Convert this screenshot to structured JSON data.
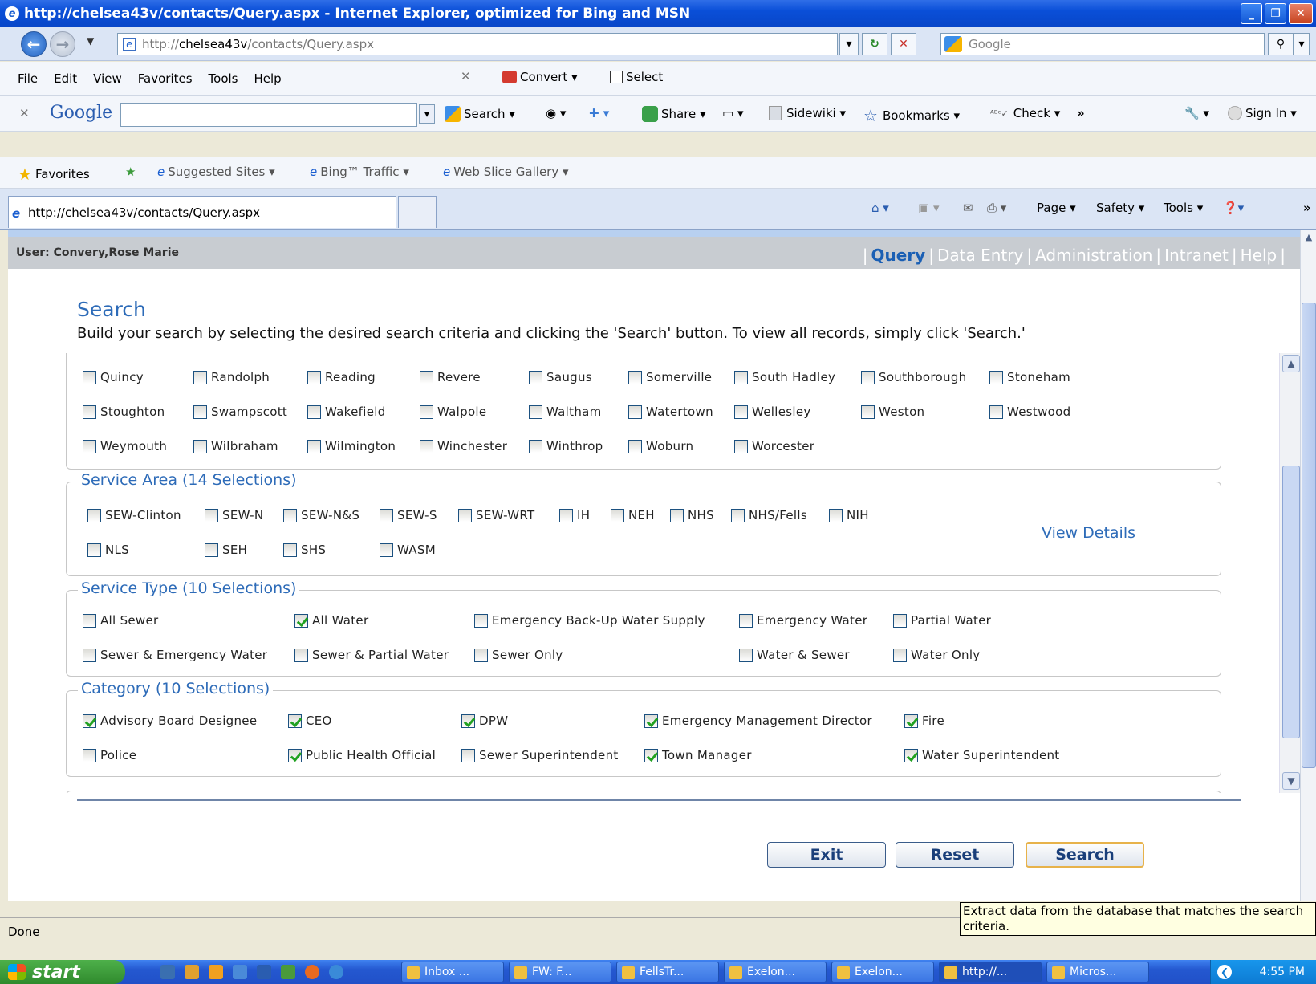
{
  "window": {
    "title": "http://chelsea43v/contacts/Query.aspx - Internet Explorer, optimized for Bing and MSN"
  },
  "addressbar": {
    "url_prefix": "http://",
    "url_host": "chelsea43v",
    "url_path": "/contacts/Query.aspx",
    "search_placeholder": "Google"
  },
  "menubar": {
    "items": [
      "File",
      "Edit",
      "View",
      "Favorites",
      "Tools",
      "Help"
    ],
    "convert_label": "Convert",
    "select_label": "Select"
  },
  "googlebar": {
    "logo": "Google",
    "search_label": "Search",
    "share_label": "Share",
    "sidewiki_label": "Sidewiki",
    "bookmarks_label": "Bookmarks",
    "check_label": "Check",
    "more_label": "»",
    "signin_label": "Sign In"
  },
  "favbar": {
    "favorites_label": "Favorites",
    "suggested_label": "Suggested Sites",
    "bing_label": "Bing™ Traffic",
    "webslice_label": "Web Slice Gallery"
  },
  "tabs": {
    "active_tab": "http://chelsea43v/contacts/Query.aspx",
    "page_label": "Page",
    "safety_label": "Safety",
    "tools_label": "Tools"
  },
  "page": {
    "user_label": "User: Convery,Rose Marie",
    "nav": [
      "Query",
      "Data Entry",
      "Administration",
      "Intranet",
      "Help"
    ],
    "active_nav": "Query",
    "search_title": "Search",
    "search_desc": "Build your search by selecting the desired search criteria and clicking the 'Search' button. To view all records, simply click 'Search.'"
  },
  "towns": {
    "rows": [
      [
        "Quincy",
        "Randolph",
        "Reading",
        "Revere",
        "Saugus",
        "Somerville",
        "South Hadley",
        "Southborough",
        "Stoneham"
      ],
      [
        "Stoughton",
        "Swampscott",
        "Wakefield",
        "Walpole",
        "Waltham",
        "Watertown",
        "Wellesley",
        "Weston",
        "Westwood"
      ],
      [
        "Weymouth",
        "Wilbraham",
        "Wilmington",
        "Winchester",
        "Winthrop",
        "Woburn",
        "Worcester"
      ]
    ]
  },
  "service_area": {
    "legend": "Service Area (14 Selections)",
    "row1": [
      "SEW-Clinton",
      "SEW-N",
      "SEW-N&S",
      "SEW-S",
      "SEW-WRT",
      "IH",
      "NEH",
      "NHS",
      "NHS/Fells",
      "NIH"
    ],
    "row2": [
      "NLS",
      "SEH",
      "SHS",
      "WASM"
    ],
    "view_details": "View Details"
  },
  "service_type": {
    "legend": "Service Type (10 Selections)",
    "items": [
      {
        "label": "All Sewer",
        "checked": false
      },
      {
        "label": "All Water",
        "checked": true
      },
      {
        "label": "Emergency Back-Up Water Supply",
        "checked": false
      },
      {
        "label": "Emergency Water",
        "checked": false
      },
      {
        "label": "Partial Water",
        "checked": false
      },
      {
        "label": "Sewer & Emergency Water",
        "checked": false
      },
      {
        "label": "Sewer & Partial Water",
        "checked": false
      },
      {
        "label": "Sewer Only",
        "checked": false
      },
      {
        "label": "Water & Sewer",
        "checked": false
      },
      {
        "label": "Water Only",
        "checked": false
      }
    ]
  },
  "category": {
    "legend": "Category (10 Selections)",
    "items": [
      {
        "label": "Advisory Board Designee",
        "checked": true
      },
      {
        "label": "CEO",
        "checked": true
      },
      {
        "label": "DPW",
        "checked": true
      },
      {
        "label": "Emergency Management Director",
        "checked": true
      },
      {
        "label": "Fire",
        "checked": true
      },
      {
        "label": "Police",
        "checked": false
      },
      {
        "label": "Public Health Official",
        "checked": true
      },
      {
        "label": "Sewer Superintendent",
        "checked": false
      },
      {
        "label": "Town Manager",
        "checked": true
      },
      {
        "label": "Water Superintendent",
        "checked": true
      }
    ]
  },
  "buttons": {
    "exit": "Exit",
    "reset": "Reset",
    "search": "Search"
  },
  "status": {
    "text": "Done",
    "tooltip": "Extract data from the database that matches the search criteria."
  },
  "taskbar": {
    "start": "start",
    "tasks": [
      "Inbox ...",
      "FW: F...",
      "FellsTr...",
      "Exelon...",
      "Exelon...",
      "http://...",
      "Micros..."
    ],
    "clock": "4:55 PM"
  }
}
